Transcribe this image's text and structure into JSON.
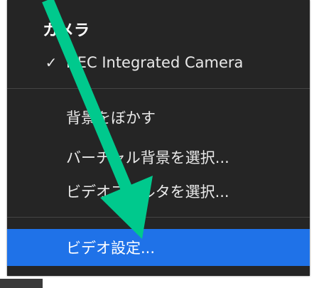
{
  "menu": {
    "heading": "カメラ",
    "camera_item": {
      "label": "NEC Integrated Camera",
      "check": "✓"
    },
    "blur_item": {
      "label": "背景をぼかす"
    },
    "virtual_bg_item": {
      "label": "バーチャル背景を選択..."
    },
    "video_filter_item": {
      "label": "ビデオフィルタを選択..."
    },
    "video_settings_item": {
      "label": "ビデオ設定..."
    }
  },
  "colors": {
    "menu_background": "#252525",
    "highlight": "#1f72e8",
    "annotation_arrow": "#00c98d"
  }
}
